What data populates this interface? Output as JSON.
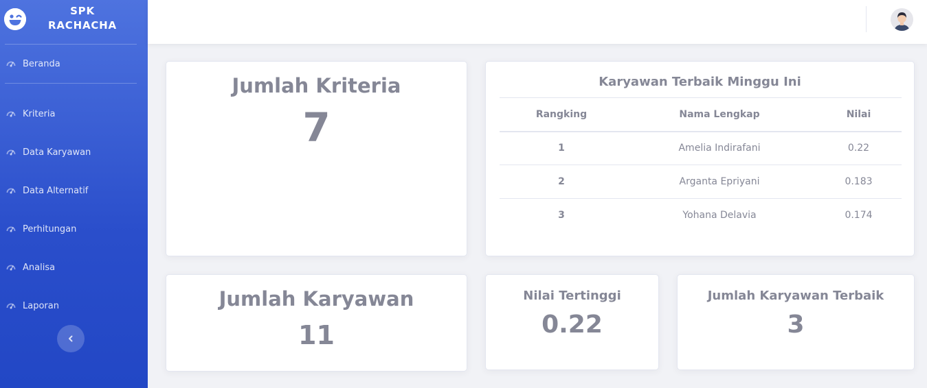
{
  "brand": {
    "line1": "SPK",
    "line2": "RACHACHA",
    "icon": "laugh-wink-icon"
  },
  "sidebar": {
    "items": [
      {
        "label": "Beranda",
        "icon": "tachometer-icon"
      },
      {
        "label": "Kriteria",
        "icon": "tachometer-icon"
      },
      {
        "label": "Data Karyawan",
        "icon": "tachometer-icon"
      },
      {
        "label": "Data Alternatif",
        "icon": "tachometer-icon"
      },
      {
        "label": "Perhitungan",
        "icon": "tachometer-icon"
      },
      {
        "label": "Analisa",
        "icon": "tachometer-icon"
      },
      {
        "label": "Laporan",
        "icon": "tachometer-icon"
      }
    ],
    "toggle_icon": "chevron-left-icon"
  },
  "topbar": {
    "avatar_icon": "user-avatar-icon"
  },
  "cards": {
    "kriteria": {
      "title": "Jumlah Kriteria",
      "value": "7"
    },
    "karyawan": {
      "title": "Jumlah Karyawan",
      "value": "11"
    },
    "nilai": {
      "title": "Nilai Tertinggi",
      "value": "0.22"
    },
    "terbaik_count": {
      "title": "Jumlah Karyawan Terbaik",
      "value": "3"
    }
  },
  "ranking": {
    "title": "Karyawan Terbaik Minggu Ini",
    "headers": [
      "Rangking",
      "Nama Lengkap",
      "Nilai"
    ],
    "rows": [
      [
        "1",
        "Amelia Indirafani",
        "0.22"
      ],
      [
        "2",
        "Arganta Epriyani",
        "0.183"
      ],
      [
        "3",
        "Yohana Delavia",
        "0.174"
      ]
    ]
  },
  "colors": {
    "sidebar_top": "#4e73df",
    "sidebar_bottom": "#2247c5",
    "text_gray": "#858796",
    "background": "#f1f2f6"
  }
}
